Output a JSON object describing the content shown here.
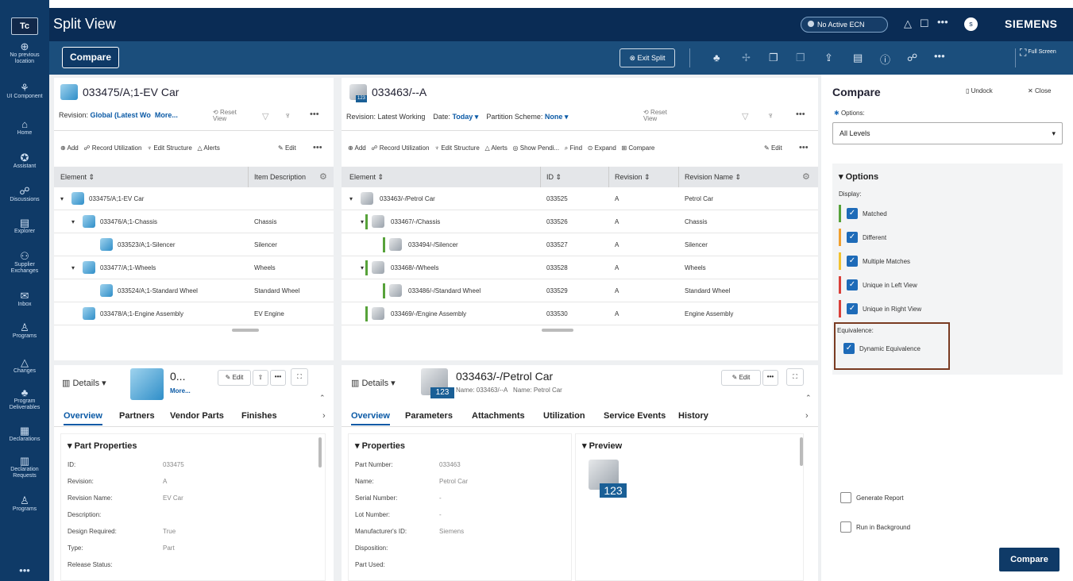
{
  "app": {
    "logo": "Tc",
    "title": "Split View",
    "ecn": "No Active ECN",
    "brand": "SIEMENS",
    "user_initial": "s"
  },
  "rail": [
    {
      "icon": "⊕",
      "label": "No previous location"
    },
    {
      "icon": "⚘",
      "label": "UI Component"
    },
    {
      "icon": "⌂",
      "label": "Home"
    },
    {
      "icon": "✪",
      "label": "Assistant"
    },
    {
      "icon": "☍",
      "label": "Discussions"
    },
    {
      "icon": "▤",
      "label": "Explorer"
    },
    {
      "icon": "⚇",
      "label": "Supplier Exchanges"
    },
    {
      "icon": "✉",
      "label": "Inbox"
    },
    {
      "icon": "♙",
      "label": "Programs"
    },
    {
      "icon": "△",
      "label": "Changes"
    },
    {
      "icon": "♣",
      "label": "Program Deliverables"
    },
    {
      "icon": "▦",
      "label": "Declarations"
    },
    {
      "icon": "▥",
      "label": "Declaration Requests"
    },
    {
      "icon": "♙",
      "label": "Programs"
    },
    {
      "icon": "•••",
      "label": ""
    }
  ],
  "toolbar": {
    "compare_label": "Compare",
    "exit_split_label": "Exit Split",
    "full_screen_label": "Full Screen"
  },
  "left": {
    "title": "033475/A;1-EV Car",
    "revision_label": "Revision:",
    "revision_value": "Global (Latest Wo",
    "more": "More...",
    "reset_view": "Reset View",
    "actions": {
      "add": "Add",
      "record": "Record Utilization",
      "edit_structure": "Edit Structure",
      "alerts": "Alerts",
      "edit": "Edit"
    },
    "columns": [
      "Element",
      "Item Description"
    ],
    "rows": [
      {
        "name": "033475/A;1-EV Car",
        "desc": ""
      },
      {
        "name": "033476/A;1-Chassis",
        "desc": "Chassis"
      },
      {
        "name": "033523/A;1-Silencer",
        "desc": "Silencer"
      },
      {
        "name": "033477/A;1-Wheels",
        "desc": "Wheels"
      },
      {
        "name": "033524/A;1-Standard Wheel",
        "desc": "Standard Wheel"
      },
      {
        "name": "033478/A;1-Engine Assembly",
        "desc": "EV Engine"
      }
    ],
    "details": {
      "label": "Details",
      "obj_title": "0...",
      "obj_more": "More...",
      "edit": "Edit",
      "tabs": [
        "Overview",
        "Partners",
        "Vendor Parts",
        "Finishes"
      ],
      "section": "Part Properties",
      "props": [
        {
          "k": "ID:",
          "v": "033475"
        },
        {
          "k": "Revision:",
          "v": "A"
        },
        {
          "k": "Revision Name:",
          "v": "EV Car"
        },
        {
          "k": "Description:",
          "v": ""
        },
        {
          "k": "Design Required:",
          "v": "True"
        },
        {
          "k": "Type:",
          "v": "Part"
        },
        {
          "k": "Release Status:",
          "v": ""
        }
      ]
    }
  },
  "right": {
    "title": "033463/--A",
    "revision_label": "Revision:",
    "revision_value": "Latest Working",
    "date_label": "Date:",
    "date_value": "Today",
    "partition_label": "Partition Scheme:",
    "partition_value": "None",
    "reset_view": "Reset View",
    "actions": {
      "add": "Add",
      "record": "Record Utilization",
      "edit_structure": "Edit Structure",
      "alerts": "Alerts",
      "show_pending": "Show Pendi...",
      "find": "Find",
      "expand": "Expand",
      "compare": "Compare",
      "edit": "Edit"
    },
    "columns": [
      "Element",
      "ID",
      "Revision",
      "Revision Name"
    ],
    "rows": [
      {
        "name": "033463/-/Petrol Car",
        "id": "033525",
        "rev": "A",
        "rname": "Petrol Car"
      },
      {
        "name": "033467/-/Chassis",
        "id": "033526",
        "rev": "A",
        "rname": "Chassis"
      },
      {
        "name": "033494/-/Silencer",
        "id": "033527",
        "rev": "A",
        "rname": "Silencer"
      },
      {
        "name": "033468/-/Wheels",
        "id": "033528",
        "rev": "A",
        "rname": "Wheels"
      },
      {
        "name": "033486/-/Standard Wheel",
        "id": "033529",
        "rev": "A",
        "rname": "Standard Wheel"
      },
      {
        "name": "033469/-/Engine Assembly",
        "id": "033530",
        "rev": "A",
        "rname": "Engine Assembly"
      }
    ],
    "details": {
      "label": "Details",
      "obj_title": "033463/-/Petrol Car",
      "obj_badge": "123",
      "name_line": "Name: 033463/--A",
      "name2": "Name: Petrol Car",
      "edit": "Edit",
      "tabs": [
        "Overview",
        "Parameters",
        "Attachments",
        "Utilization",
        "Service Events",
        "History"
      ],
      "section": "Properties",
      "preview": "Preview",
      "preview_badge": "123",
      "props": [
        {
          "k": "Part Number:",
          "v": "033463"
        },
        {
          "k": "Name:",
          "v": "Petrol Car"
        },
        {
          "k": "Serial Number:",
          "v": "-"
        },
        {
          "k": "Lot Number:",
          "v": "-"
        },
        {
          "k": "Manufacturer's ID:",
          "v": "Siemens"
        },
        {
          "k": "Disposition:",
          "v": ""
        },
        {
          "k": "Part Used:",
          "v": ""
        }
      ]
    }
  },
  "compare": {
    "title": "Compare",
    "undock": "Undock",
    "close": "Close",
    "options_label": "Options:",
    "level": "All Levels",
    "options_header": "Options",
    "display_label": "Display:",
    "display": [
      {
        "label": "Matched",
        "color": "#57a23a"
      },
      {
        "label": "Different",
        "color": "#f0a030"
      },
      {
        "label": "Multiple Matches",
        "color": "#f2c230"
      },
      {
        "label": "Unique in Left View",
        "color": "#d9403a"
      },
      {
        "label": "Unique in Right View",
        "color": "#d9403a"
      }
    ],
    "equivalence_label": "Equivalence:",
    "dynamic": "Dynamic Equivalence",
    "generate_report": "Generate Report",
    "run_background": "Run in Background",
    "compare_button": "Compare"
  }
}
